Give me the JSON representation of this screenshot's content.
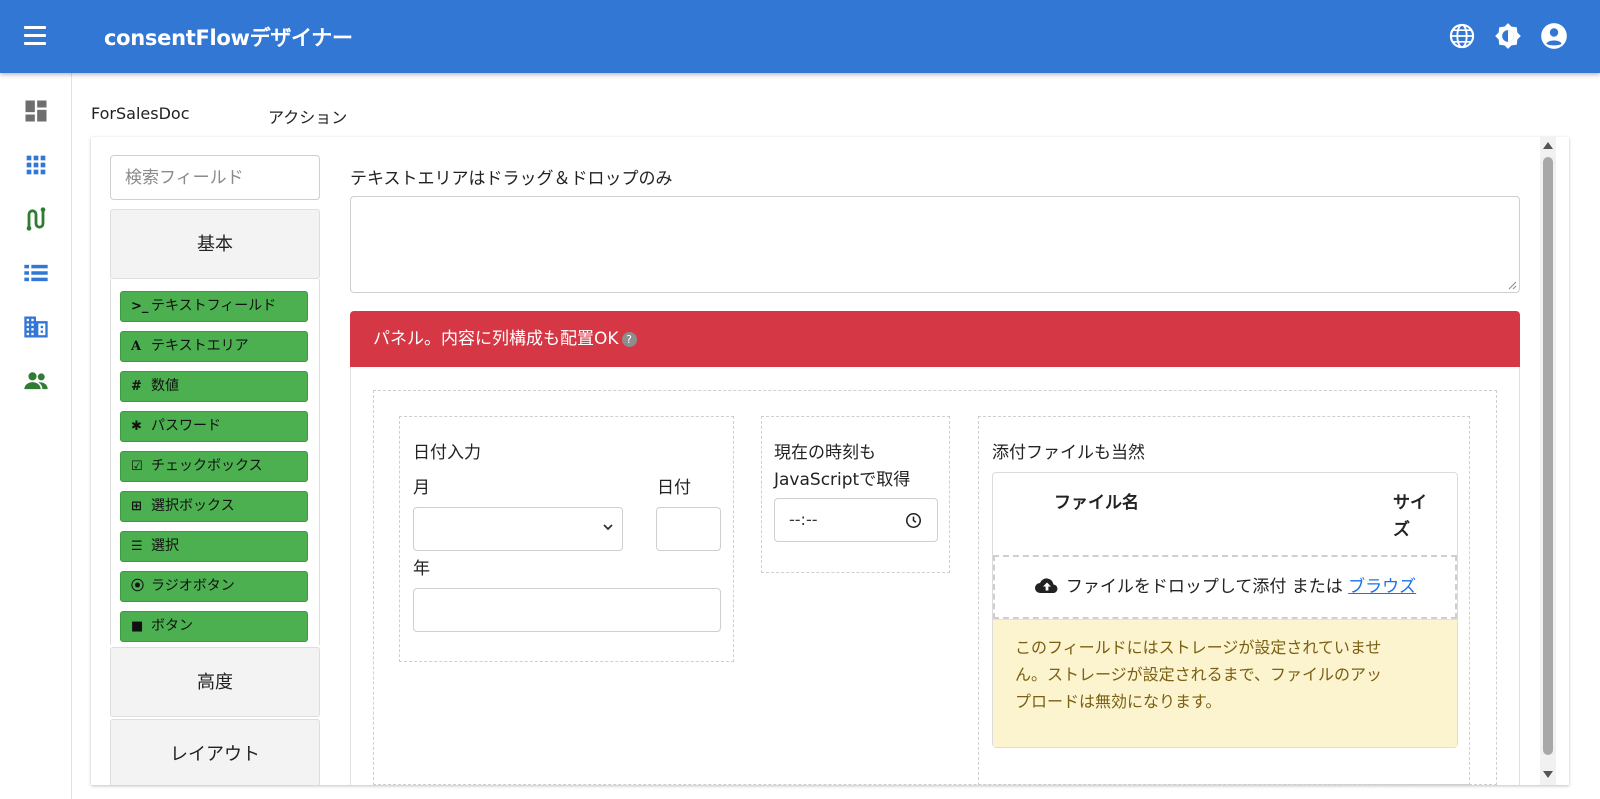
{
  "app": {
    "title": "consentFlowデザイナー"
  },
  "tabs": [
    {
      "label": "ForSalesDoc"
    },
    {
      "label": "アクション"
    }
  ],
  "rail_icons": [
    "dashboard-icon",
    "apps-grid-icon",
    "route-icon",
    "list-icon",
    "building-icon",
    "people-icon"
  ],
  "palette": {
    "search_placeholder": "検索フィールド",
    "groups": [
      {
        "label": "基本"
      },
      {
        "label": "高度"
      },
      {
        "label": "レイアウト"
      }
    ],
    "components": [
      {
        "icon": ">_",
        "label": "テキストフィールド"
      },
      {
        "icon": "A",
        "label": "テキストエリア"
      },
      {
        "icon": "#",
        "label": "数値"
      },
      {
        "icon": "✱",
        "label": "パスワード"
      },
      {
        "icon": "☑",
        "label": "チェックボックス"
      },
      {
        "icon": "⊞",
        "label": "選択ボックス"
      },
      {
        "icon": "☰",
        "label": "選択"
      },
      {
        "icon": "⦿",
        "label": "ラジオボタン"
      },
      {
        "icon": "■",
        "label": "ボタン"
      }
    ]
  },
  "form": {
    "textarea_label": "テキストエリアはドラッグ＆ドロップのみ",
    "panel": {
      "title": "パネル。内容に列構成も配置OK",
      "help": "?"
    },
    "date": {
      "label": "日付入力",
      "month_label": "月",
      "day_label": "日付",
      "year_label": "年"
    },
    "time": {
      "label_line1": "現在の時刻も",
      "label_line2": "JavaScriptで取得",
      "value": "--:--"
    },
    "file": {
      "label": "添付ファイルも当然",
      "col_name": "ファイル名",
      "col_size_line1": "サイ",
      "col_size_line2": "ズ",
      "drop_text": "ファイルをドロップして添付 または",
      "browse": "ブラウズ",
      "warning_line1": "このフィールドにはストレージが設定されていませ",
      "warning_line2": "ん。ストレージが設定されるまで、ファイルのアッ",
      "warning_line3": "プロードは無効になります。"
    }
  },
  "colors": {
    "appbar": "#3377d4",
    "component": "#4caf50",
    "panel_header": "#d63745",
    "warning_bg": "#fcf3cf",
    "link": "#1a73e8"
  }
}
